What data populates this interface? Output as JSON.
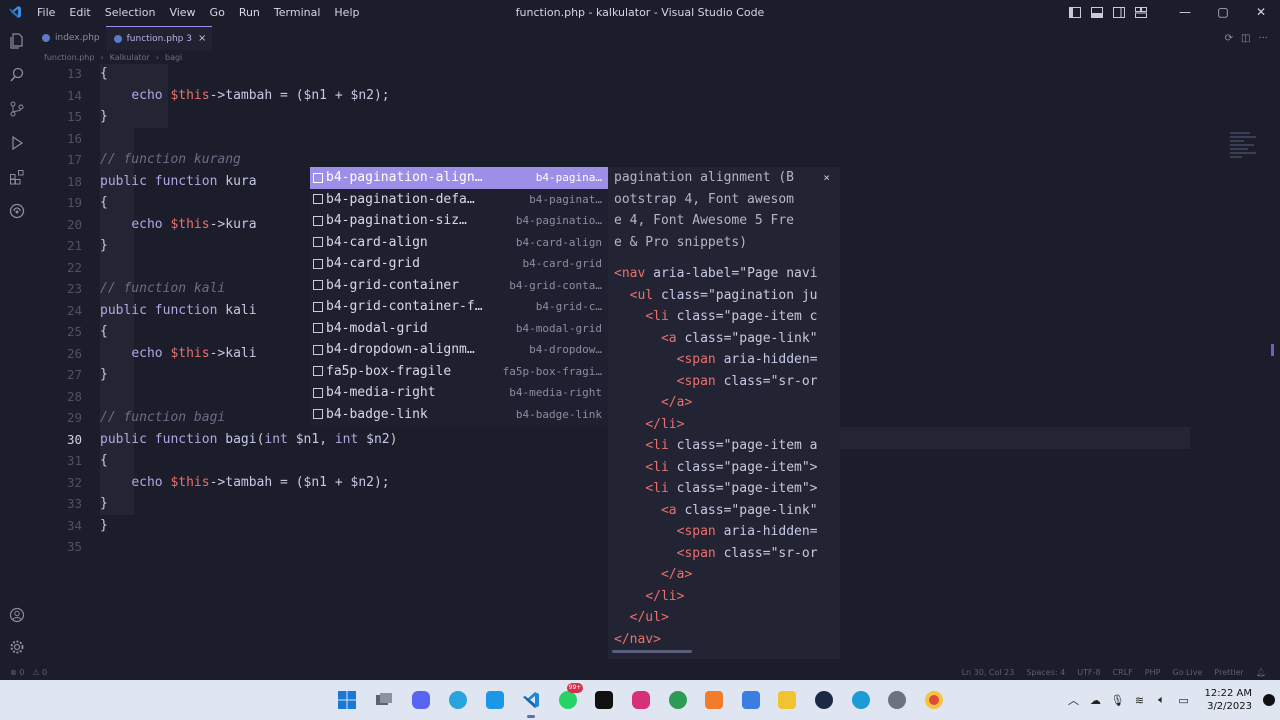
{
  "window": {
    "title": "function.php - kalkulator - Visual Studio Code",
    "menu": [
      "File",
      "Edit",
      "Selection",
      "View",
      "Go",
      "Run",
      "Terminal",
      "Help"
    ]
  },
  "tabs": [
    {
      "label": "index.php",
      "active": false
    },
    {
      "label": "function.php 3",
      "active": true
    }
  ],
  "breadcrumb": [
    "function.php",
    "Kalkulator",
    "bagi"
  ],
  "editor": {
    "line_numbers": [
      "13",
      "14",
      "15",
      "16",
      "17",
      "18",
      "19",
      "20",
      "21",
      "22",
      "23",
      "24",
      "25",
      "26",
      "27",
      "28",
      "29",
      "30",
      "31",
      "32",
      "33",
      "34",
      "35"
    ],
    "current_line": "30"
  },
  "suggest": {
    "items": [
      {
        "label": "b4-pagination-align…",
        "detail": "b4-pagina…",
        "selected": true
      },
      {
        "label": "b4-pagination-defa…",
        "detail": "b4-paginat…"
      },
      {
        "label": "b4-pagination-siz…",
        "detail": "b4-paginatio…"
      },
      {
        "label": "b4-card-align",
        "detail": "b4-card-align"
      },
      {
        "label": "b4-card-grid",
        "detail": "b4-card-grid"
      },
      {
        "label": "b4-grid-container",
        "detail": "b4-grid-conta…"
      },
      {
        "label": "b4-grid-container-f…",
        "detail": "b4-grid-c…"
      },
      {
        "label": "b4-modal-grid",
        "detail": "b4-modal-grid"
      },
      {
        "label": "b4-dropdown-alignm…",
        "detail": "b4-dropdow…"
      },
      {
        "label": "fa5p-box-fragile",
        "detail": "fa5p-box-fragi…"
      },
      {
        "label": "b4-media-right",
        "detail": "b4-media-right"
      },
      {
        "label": "b4-badge-link",
        "detail": "b4-badge-link"
      }
    ]
  },
  "docs": {
    "description": [
      "pagination alignment (B",
      "ootstrap 4, Font awesom",
      "e 4, Font Awesome 5 Fre",
      "e & Pro snippets)"
    ],
    "close": "×"
  },
  "statusbar": {
    "left": [
      "⊗ 0",
      "⚠ 0"
    ],
    "right": [
      "Ln 30, Col 23",
      "Spaces: 4",
      "UTF-8",
      "CRLF",
      "PHP",
      "Go Live",
      "Prettier"
    ]
  },
  "taskbar": {
    "time": "12:22 AM",
    "date": "3/2/2023",
    "badges": {
      "discord": "",
      "telegram": "",
      "whatsapp": "99+"
    }
  },
  "colors": {
    "accent": "#9d8fe8",
    "keyword": "#b2a6e6",
    "variable": "#e9706e",
    "background": "#1b1d2a"
  }
}
